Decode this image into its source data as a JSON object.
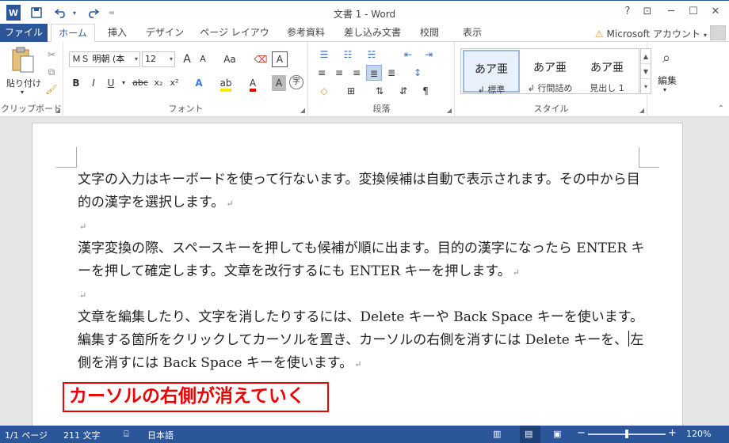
{
  "window": {
    "title": "文書 1 - Word",
    "app_icon": "W",
    "help": "?",
    "restore_ribbon": "⊡",
    "minimize": "─",
    "maximize": "☐",
    "close": "✕"
  },
  "quick_access": {
    "save_icon": "save-icon",
    "undo_icon": "undo-icon",
    "redo_icon": "redo-icon",
    "customize": "="
  },
  "tabs": [
    {
      "label": "ファイル"
    },
    {
      "label": "ホーム"
    },
    {
      "label": "挿入"
    },
    {
      "label": "デザイン"
    },
    {
      "label": "ページ レイアウト"
    },
    {
      "label": "参考資料"
    },
    {
      "label": "差し込み文書"
    },
    {
      "label": "校閲"
    },
    {
      "label": "表示"
    }
  ],
  "account": {
    "label": "Microsoft アカウント",
    "warning": "⚠"
  },
  "ribbon": {
    "clipboard": {
      "paste_label": "貼り付け",
      "group_label": "クリップボード"
    },
    "font": {
      "font_name": "ＭＳ 明朝 (本",
      "font_size": "12",
      "grow": "A",
      "shrink": "A",
      "case": "Aa",
      "bold": "B",
      "italic": "I",
      "underline": "U",
      "strike": "abc",
      "subscript": "x₂",
      "superscript": "x²",
      "group_label": "フォント"
    },
    "paragraph": {
      "group_label": "段落"
    },
    "styles": {
      "items": [
        {
          "sample": "あア亜",
          "name": "↲ 標準"
        },
        {
          "sample": "あア亜",
          "name": "↲ 行間詰め"
        },
        {
          "sample": "あア亜",
          "name": "見出し 1"
        }
      ],
      "group_label": "スタイル"
    },
    "editing": {
      "label": "編集"
    }
  },
  "document": {
    "paragraphs": [
      "文字の入力はキーボードを使って行ないます。変換候補は自動で表示されます。その中から目的の漢字を選択します。",
      "漢字変換の際、スペースキーを押しても候補が順に出ます。目的の漢字になったら ENTER キーを押して確定します。文章を改行するにも ENTER キーを押します。",
      "文章を編集したり、文字を消したりするには、Delete キーや Back Space キーを使います。編集する箇所をクリックしてカーソルを置き、カーソルの右側を消すには Delete キーを、",
      "左側を消すには Back Space キーを使います。"
    ],
    "paragraph_mark": "↵",
    "callout": "カーソルの右側が消えていく"
  },
  "status": {
    "page": "1/1 ページ",
    "words": "211 文字",
    "language": "日本語",
    "zoom": "120%",
    "zoom_minus": "−",
    "zoom_plus": "+"
  }
}
